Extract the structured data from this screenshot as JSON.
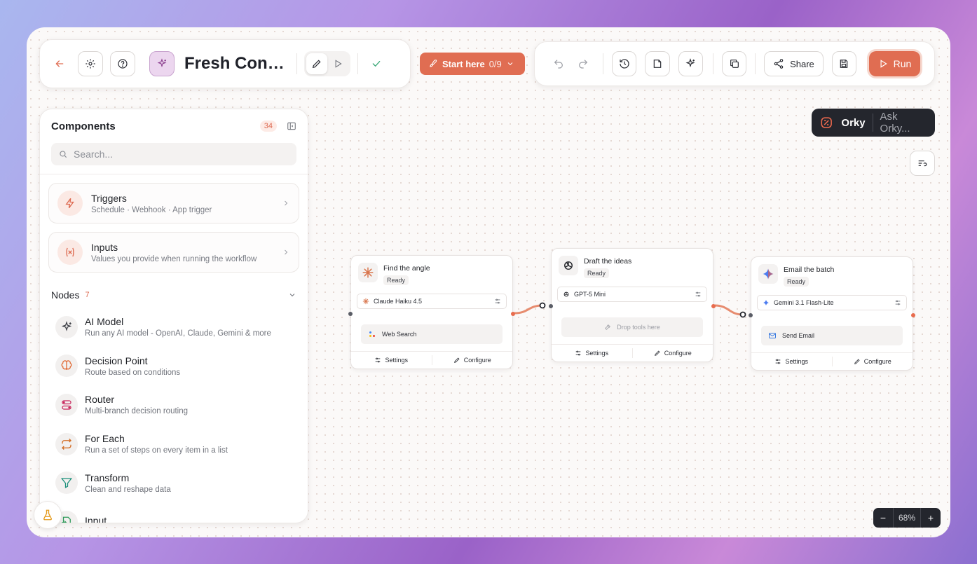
{
  "header": {
    "title": "Fresh Content Ideas",
    "start_label": "Start here",
    "start_progress": "0/9",
    "share_label": "Share",
    "run_label": "Run"
  },
  "orky": {
    "name": "Orky",
    "ask_placeholder": "Ask Orky..."
  },
  "sidebar": {
    "title": "Components",
    "count": "34",
    "search_placeholder": "Search...",
    "groups": [
      {
        "title": "Triggers",
        "subtitle": "Schedule · Webhook · App trigger",
        "icon": "lightning-icon"
      },
      {
        "title": "Inputs",
        "subtitle": "Values you provide when running the workflow",
        "icon": "variable-icon"
      }
    ],
    "nodes_label": "Nodes",
    "nodes_count": "7",
    "nodes": [
      {
        "title": "AI Model",
        "subtitle": "Run any AI model - OpenAI, Claude, Gemini & more",
        "icon": "sparkles-icon"
      },
      {
        "title": "Decision Point",
        "subtitle": "Route based on conditions",
        "icon": "brain-icon"
      },
      {
        "title": "Router",
        "subtitle": "Multi-branch decision routing",
        "icon": "route-icon"
      },
      {
        "title": "For Each",
        "subtitle": "Run a set of steps on every item in a list",
        "icon": "repeat-icon"
      },
      {
        "title": "Transform",
        "subtitle": "Clean and reshape data",
        "icon": "filter-icon"
      },
      {
        "title": "Input",
        "subtitle": "",
        "icon": "file-input-icon"
      }
    ]
  },
  "workflow": {
    "nodes": [
      {
        "title": "Find the angle",
        "status": "Ready",
        "model": "Claude Haiku 4.5",
        "tool": "Web Search",
        "settings": "Settings",
        "configure": "Configure"
      },
      {
        "title": "Draft the ideas",
        "status": "Ready",
        "model": "GPT-5 Mini",
        "tool": "Drop tools here",
        "settings": "Settings",
        "configure": "Configure"
      },
      {
        "title": "Email the batch",
        "status": "Ready",
        "model": "Gemini 3.1 Flash-Lite",
        "tool": "Send Email",
        "settings": "Settings",
        "configure": "Configure"
      }
    ]
  },
  "zoom": {
    "value": "68%",
    "minus": "−",
    "plus": "+"
  },
  "colors": {
    "accent": "#e06d52",
    "dark": "#24262d"
  }
}
